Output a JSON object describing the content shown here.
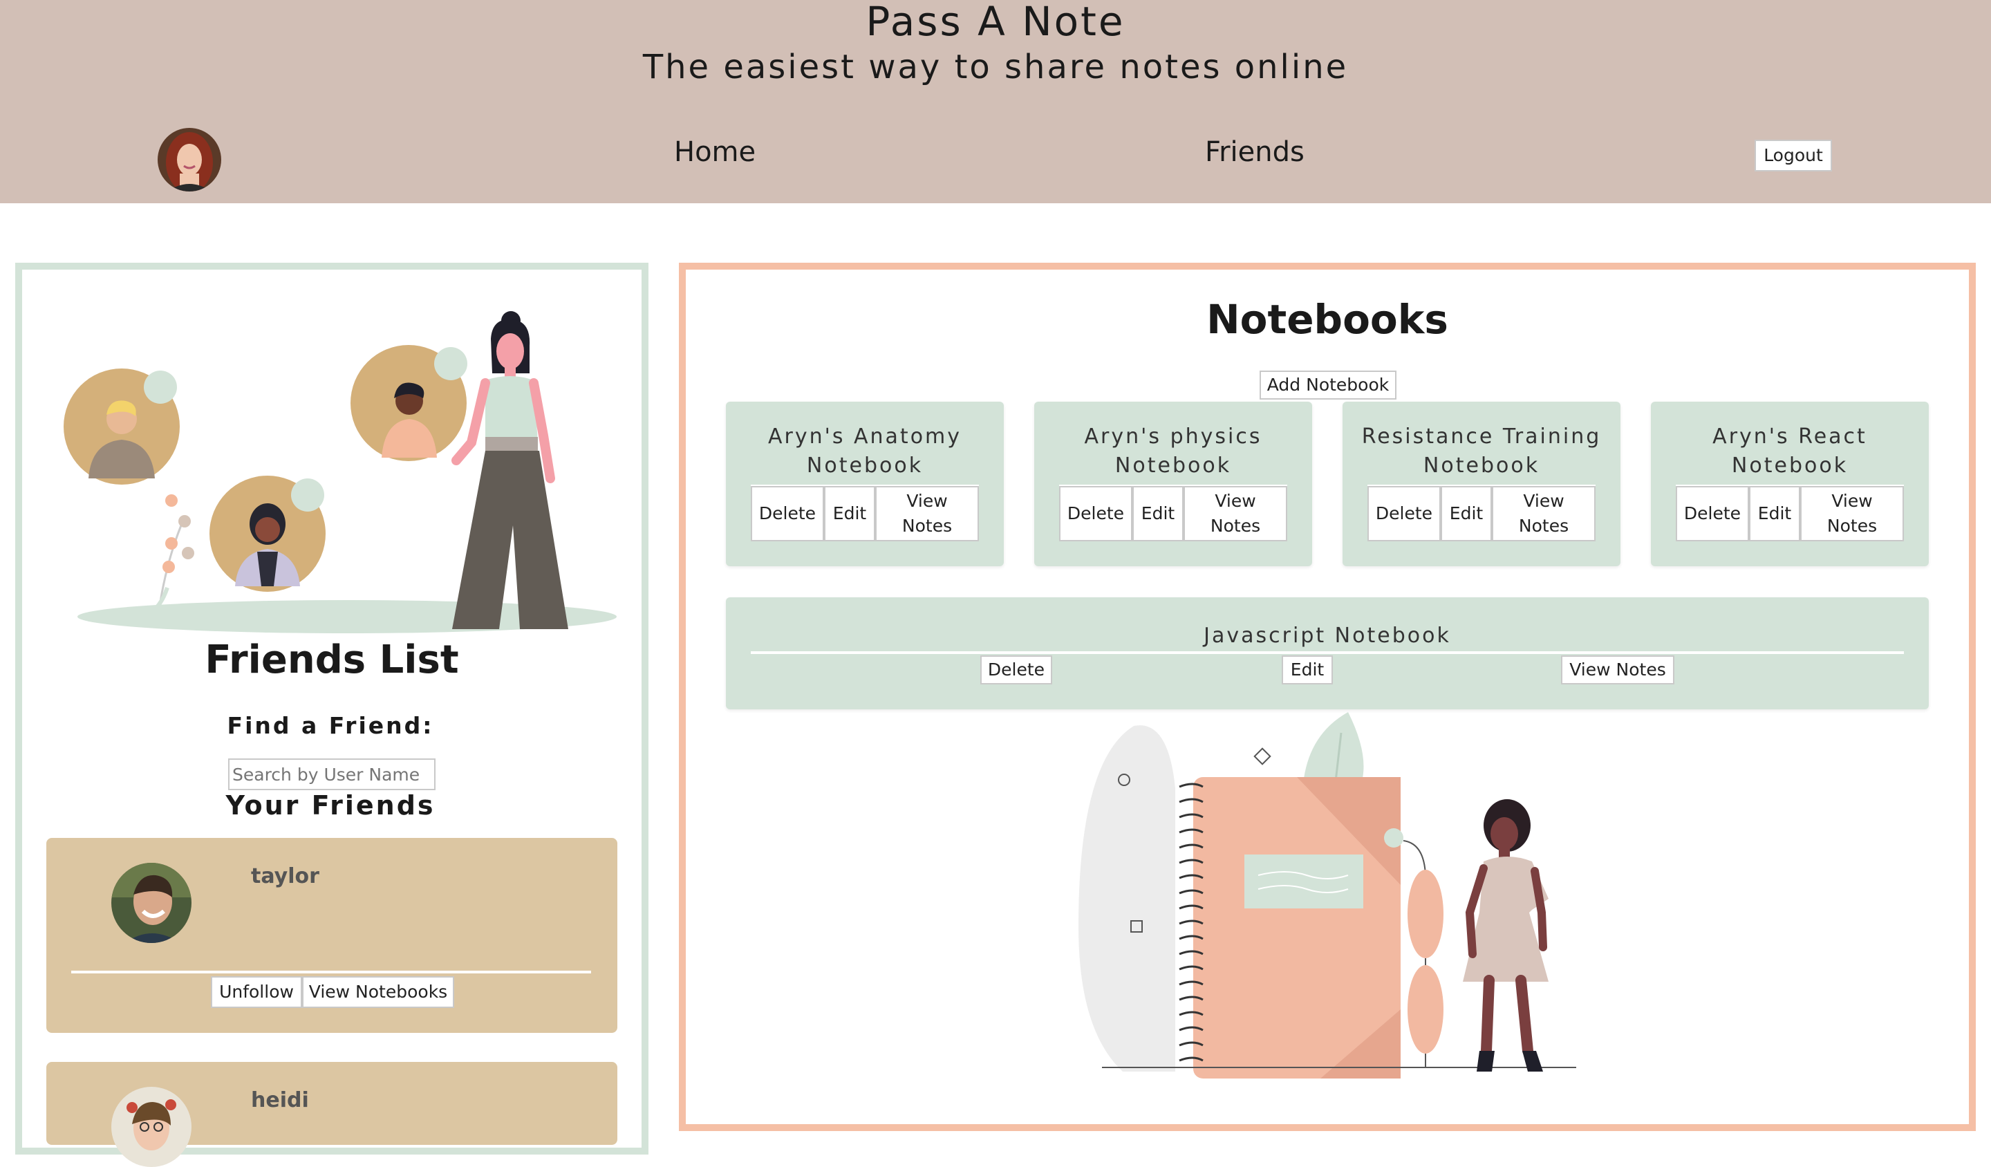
{
  "header": {
    "title": "Pass A Note",
    "subtitle": "The easiest way to share notes online",
    "nav": {
      "home": "Home",
      "friends": "Friends"
    },
    "logout_label": "Logout"
  },
  "friends_panel": {
    "title": "Friends List",
    "find_label": "Find a Friend:",
    "search_placeholder": "Search by User Name",
    "your_friends_label": "Your Friends",
    "friends": [
      {
        "name": "taylor",
        "unfollow_label": "Unfollow",
        "view_label": "View Notebooks"
      },
      {
        "name": "heidi"
      }
    ]
  },
  "notebooks_panel": {
    "title": "Notebooks",
    "add_label": "Add Notebook",
    "notebooks": [
      {
        "title": "Aryn's Anatomy Notebook",
        "delete_label": "Delete",
        "edit_label": "Edit",
        "view_label": "View Notes"
      },
      {
        "title": "Aryn's physics Notebook",
        "delete_label": "Delete",
        "edit_label": "Edit",
        "view_label": "View Notes"
      },
      {
        "title": "Resistance Training Notebook",
        "delete_label": "Delete",
        "edit_label": "Edit",
        "view_label": "View Notes"
      },
      {
        "title": "Aryn's React Notebook",
        "delete_label": "Delete",
        "edit_label": "Edit",
        "view_label": "View Notes"
      }
    ],
    "wide_notebook": {
      "title": "Javascript Notebook",
      "delete_label": "Delete",
      "edit_label": "Edit",
      "view_label": "View Notes"
    }
  },
  "colors": {
    "header_bg": "#d2bfb6",
    "friends_border": "#d3e3d8",
    "notebooks_border": "#f5bfa5",
    "notebook_card": "#d3e3d8",
    "friend_card": "#dcc6a2"
  }
}
